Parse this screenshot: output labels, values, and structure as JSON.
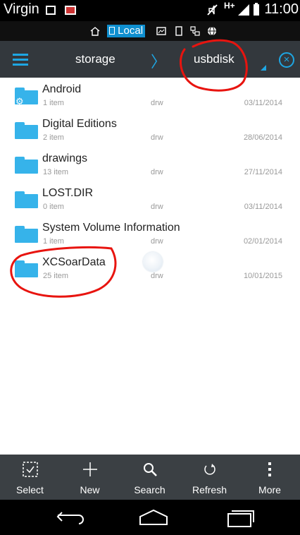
{
  "status_bar": {
    "carrier": "Virgin",
    "network": "H+",
    "time": "11:00"
  },
  "location_bar": {
    "selected": "Local",
    "icons": [
      "home-icon",
      "phone-icon",
      "image-icon",
      "tablet-icon",
      "network-icon",
      "globe-icon"
    ]
  },
  "path_bar": {
    "crumbs": [
      "storage",
      "usbdisk"
    ],
    "icons": [
      "menu-icon",
      "chevron-right-icon",
      "close-circle-icon"
    ]
  },
  "files": [
    {
      "name": "Android",
      "count": "1 item",
      "perm": "drw",
      "date": "03/11/2014",
      "icon": "folder-settings-icon"
    },
    {
      "name": "Digital Editions",
      "count": "2 item",
      "perm": "drw",
      "date": "28/06/2014",
      "icon": "folder-icon"
    },
    {
      "name": "drawings",
      "count": "13 item",
      "perm": "drw",
      "date": "27/11/2014",
      "icon": "folder-icon"
    },
    {
      "name": "LOST.DIR",
      "count": "0 item",
      "perm": "drw",
      "date": "03/11/2014",
      "icon": "folder-icon"
    },
    {
      "name": "System Volume Information",
      "count": "1 item",
      "perm": "drw",
      "date": "02/01/2014",
      "icon": "folder-icon"
    },
    {
      "name": "XCSoarData",
      "count": "25 item",
      "perm": "drw",
      "date": "10/01/2015",
      "icon": "folder-icon"
    }
  ],
  "toolbar": {
    "items": [
      {
        "label": "Select",
        "icon": "select-icon"
      },
      {
        "label": "New",
        "icon": "plus-icon"
      },
      {
        "label": "Search",
        "icon": "search-icon"
      },
      {
        "label": "Refresh",
        "icon": "refresh-icon"
      },
      {
        "label": "More",
        "icon": "more-icon"
      }
    ]
  },
  "nav_bar": {
    "icons": [
      "back-icon",
      "home-icon",
      "recents-icon"
    ]
  },
  "colors": {
    "accent": "#1ea6e3",
    "folder": "#36b3ea",
    "header_bg": "#33383d",
    "toolbar_bg": "#3b4044",
    "annotation": "#e8140f"
  }
}
